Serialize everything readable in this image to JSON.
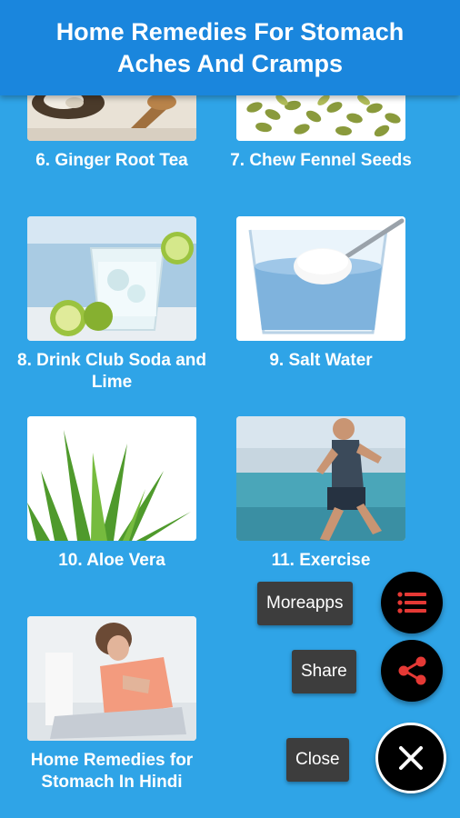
{
  "header": {
    "title": "Home Remedies For Stomach Aches And Cramps"
  },
  "remedies": [
    {
      "label": "6. Ginger Root Tea",
      "image": "ginger-root-tea-image"
    },
    {
      "label": "7. Chew Fennel Seeds",
      "image": "fennel-seeds-image"
    },
    {
      "label": "8. Drink Club Soda and Lime",
      "image": "club-soda-lime-image"
    },
    {
      "label": "9. Salt Water",
      "image": "salt-water-image"
    },
    {
      "label": "10. Aloe Vera",
      "image": "aloe-vera-image"
    },
    {
      "label": "11. Exercise",
      "image": "exercise-image"
    },
    {
      "label": "Home Remedies for Stomach In Hindi",
      "image": "stomach-ache-image"
    }
  ],
  "fab_menu": {
    "more_apps_label": "Moreapps",
    "share_label": "Share",
    "close_label": "Close",
    "more_apps_icon": "list-icon",
    "share_icon": "share-icon",
    "close_icon": "close-icon",
    "accent_color": "#e53935",
    "fab_color": "#000000"
  },
  "colors": {
    "header_bg": "#1a86dd",
    "page_bg": "#2fa4e7",
    "label_bg": "#3d3d3d"
  }
}
